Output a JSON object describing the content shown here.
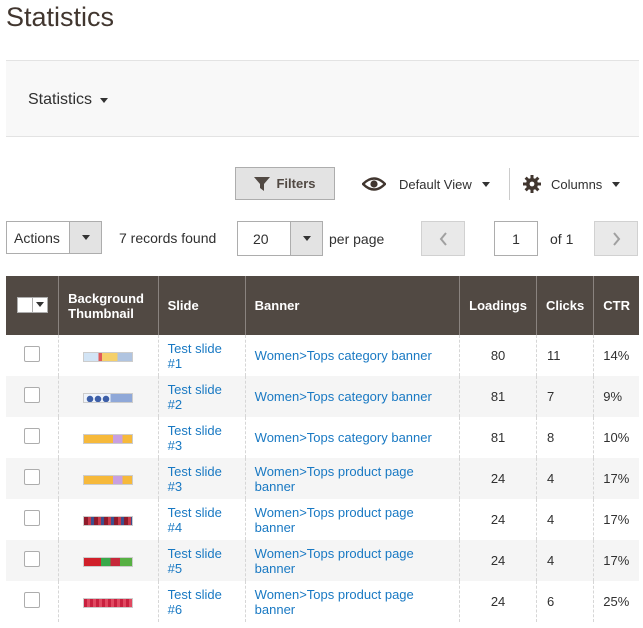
{
  "page": {
    "title": "Statistics"
  },
  "stats_switcher": {
    "label": "Statistics"
  },
  "toolbar": {
    "filters_label": "Filters",
    "view_label": "Default View",
    "columns_label": "Columns"
  },
  "grid_controls": {
    "actions_label": "Actions",
    "records_text": "7 records found",
    "per_page_value": "20",
    "per_page_text": "per page",
    "current_page": "1",
    "of_text": "of 1"
  },
  "table": {
    "headers": {
      "thumbnail": "Background Thumbnail",
      "slide": "Slide",
      "banner": "Banner",
      "loadings": "Loadings",
      "clicks": "Clicks",
      "ctr": "CTR"
    },
    "rows": [
      {
        "thumb": "t-mixed",
        "slide": "Test slide #1",
        "banner": "Women>Tops category banner",
        "loadings": "80",
        "clicks": "11",
        "ctr": "14%"
      },
      {
        "thumb": "t-dots",
        "slide": "Test slide #2",
        "banner": "Women>Tops category banner",
        "loadings": "81",
        "clicks": "7",
        "ctr": "9%"
      },
      {
        "thumb": "t-orange",
        "slide": "Test slide #3",
        "banner": "Women>Tops category banner",
        "loadings": "81",
        "clicks": "8",
        "ctr": "10%"
      },
      {
        "thumb": "t-orange",
        "slide": "Test slide #3",
        "banner": "Women>Tops product page banner",
        "loadings": "24",
        "clicks": "4",
        "ctr": "17%"
      },
      {
        "thumb": "t-berries",
        "slide": "Test slide #4",
        "banner": "Women>Tops product page banner",
        "loadings": "24",
        "clicks": "4",
        "ctr": "17%"
      },
      {
        "thumb": "t-red-green",
        "slide": "Test slide #5",
        "banner": "Women>Tops product page banner",
        "loadings": "24",
        "clicks": "4",
        "ctr": "17%"
      },
      {
        "thumb": "t-red",
        "slide": "Test slide #6",
        "banner": "Women>Tops product page banner",
        "loadings": "24",
        "clicks": "6",
        "ctr": "25%"
      }
    ]
  },
  "colors": {
    "header_bg": "#514943",
    "link": "#1979c3",
    "filters_bg": "#e3e3e3"
  },
  "icons": {
    "filter": "filter-icon",
    "view": "eye-icon",
    "columns": "gear-icon",
    "prev": "chevron-left-icon",
    "next": "chevron-right-icon"
  }
}
